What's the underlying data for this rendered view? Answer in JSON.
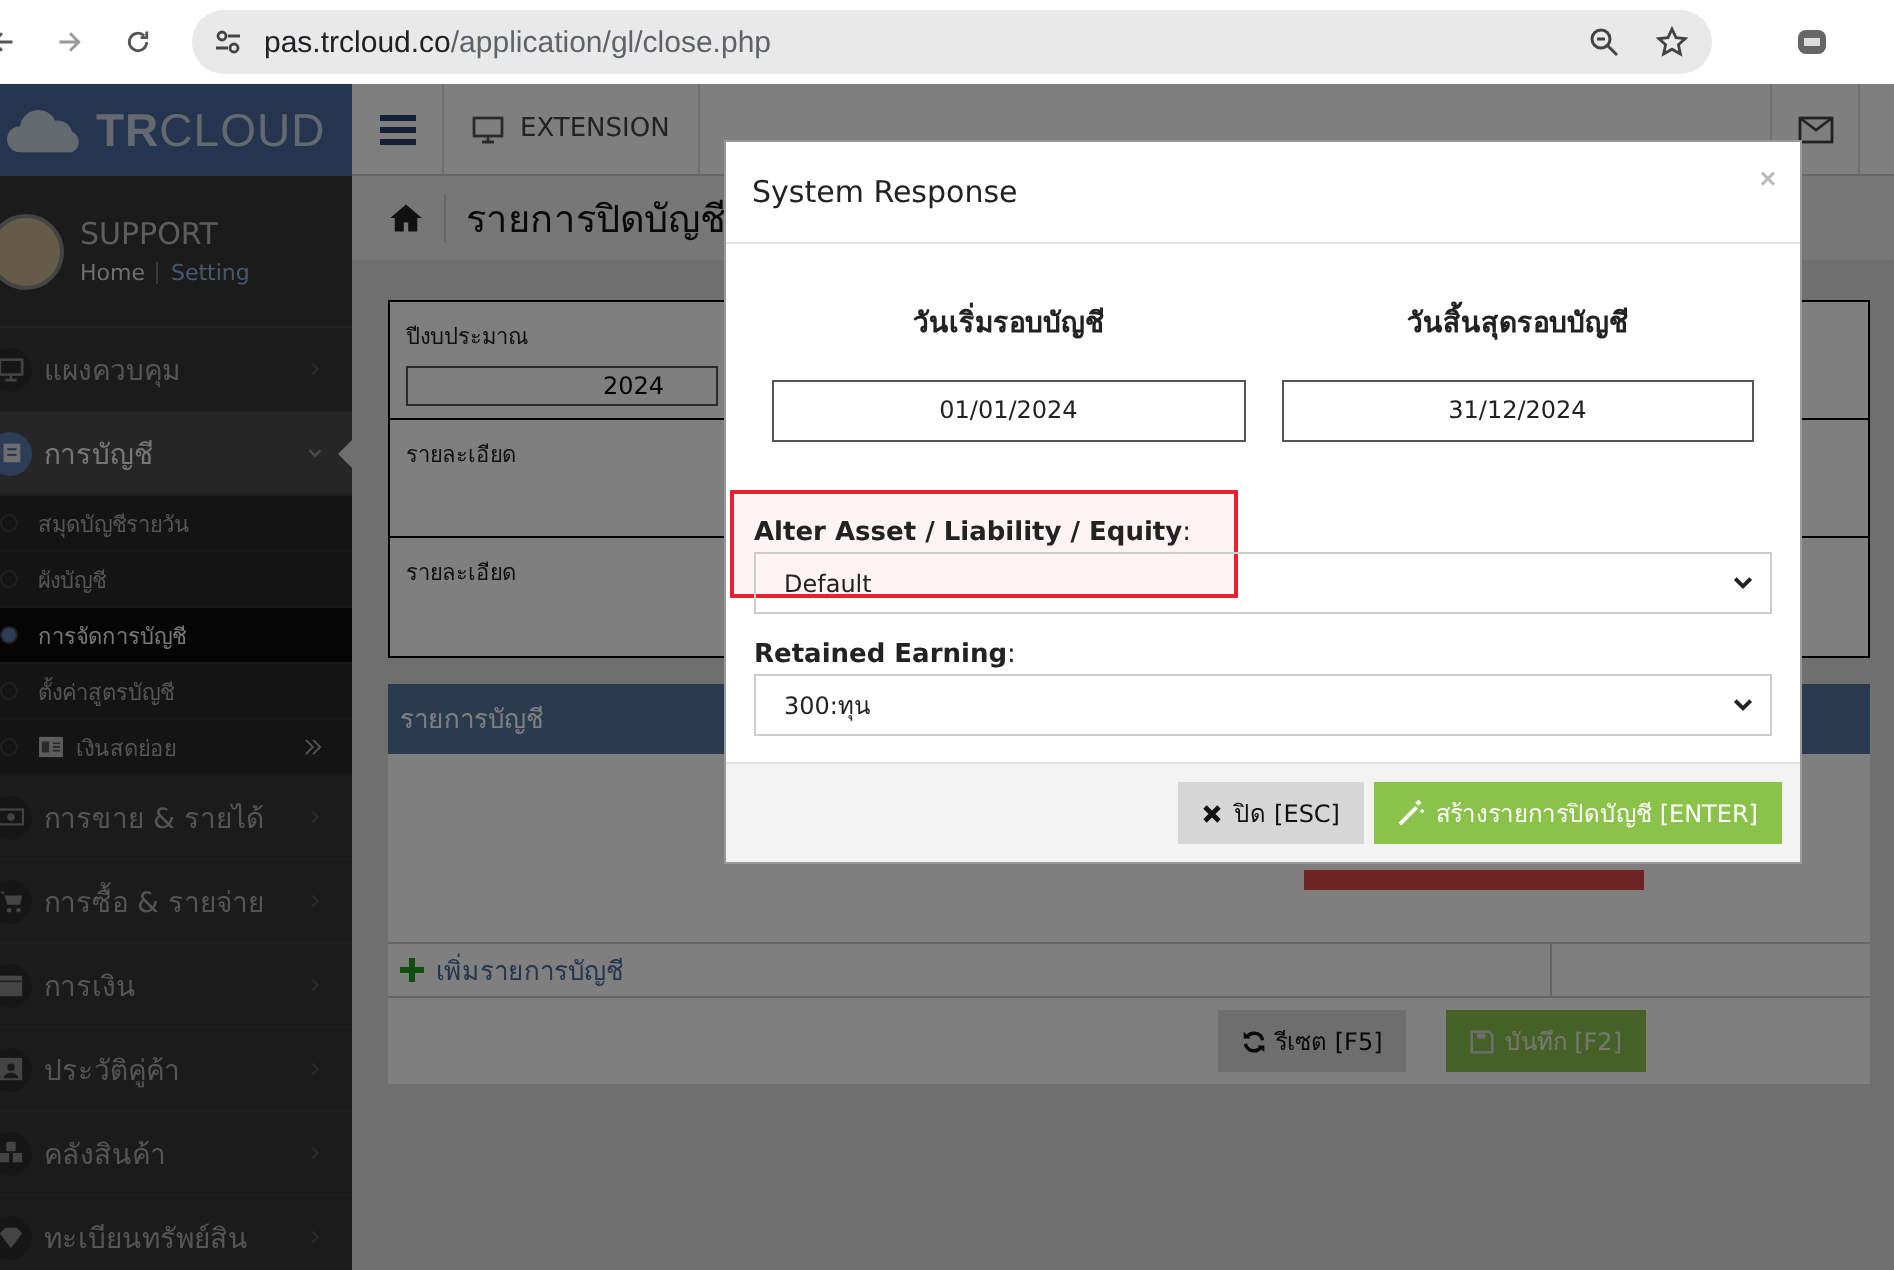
{
  "browser": {
    "url_host": "pas.trcloud.co",
    "url_path": "/application/gl/close.php"
  },
  "header": {
    "logo": "**TR**CLOUD",
    "nav_label": "EXTENSION"
  },
  "user": {
    "name": "SUPPORT",
    "home": "Home",
    "setting": "Setting"
  },
  "sidebar": {
    "items": [
      {
        "label": "แผงควบคุม",
        "kind": "dashboard",
        "expanded": false
      },
      {
        "label": "การบัญชี",
        "kind": "accounting",
        "expanded": true,
        "children": [
          {
            "label": "สมุดบัญชีรายวัน",
            "selected": false,
            "kind": "plain"
          },
          {
            "label": "ผังบัญชี",
            "selected": false,
            "kind": "plain"
          },
          {
            "label": "การจัดการบัญชี",
            "selected": true,
            "kind": "plain"
          },
          {
            "label": "ตั้งค่าสูตรบัญชี",
            "selected": false,
            "kind": "plain"
          },
          {
            "label": "เงินสดย่อย",
            "selected": false,
            "kind": "submenu"
          }
        ]
      },
      {
        "label": "การขาย & รายได้",
        "kind": "sales",
        "expanded": false
      },
      {
        "label": "การซื้อ & รายจ่าย",
        "kind": "purchase",
        "expanded": false
      },
      {
        "label": "การเงิน",
        "kind": "finance",
        "expanded": false
      },
      {
        "label": "ประวัติคู่ค้า",
        "kind": "contacts",
        "expanded": false
      },
      {
        "label": "คลังสินค้า",
        "kind": "inventory",
        "expanded": false
      },
      {
        "label": "ทะเบียนทรัพย์สิน",
        "kind": "assets",
        "expanded": false
      }
    ]
  },
  "page": {
    "title": "รายการปิดบัญชี",
    "form_rows": [
      {
        "label": "ปีงบประมาณ",
        "value": "2024",
        "kind": "input"
      },
      {
        "label": "รายละเอียด",
        "kind": "text"
      },
      {
        "label": "รายละเอียด",
        "kind": "text"
      }
    ],
    "section_title": "รายการบัญชี",
    "add_link": "เพิ่มรายการบัญชี",
    "buttons": [
      {
        "label": "รีเซต [F5]",
        "kind": "reset"
      },
      {
        "label": "บันทึก [F2]",
        "kind": "save"
      }
    ]
  },
  "modal": {
    "title": "System Response",
    "close": "×",
    "periods": [
      {
        "label": "วันเริ่มรอบบัญชี",
        "value": "01/01/2024"
      },
      {
        "label": "วันสิ้นสุดรอบบัญชี",
        "value": "31/12/2024"
      }
    ],
    "selects": [
      {
        "label": "**Alter Asset / Liability / Equity**:",
        "value": "Default",
        "highlighted": true
      },
      {
        "label": "**Retained Earning**:",
        "value": "300:ทุน",
        "highlighted": false
      }
    ],
    "buttons": [
      {
        "label": "ปิด [ESC]",
        "kind": "close"
      },
      {
        "label": "สร้างรายการปิดบัญชี [ENTER]",
        "kind": "create"
      }
    ]
  }
}
